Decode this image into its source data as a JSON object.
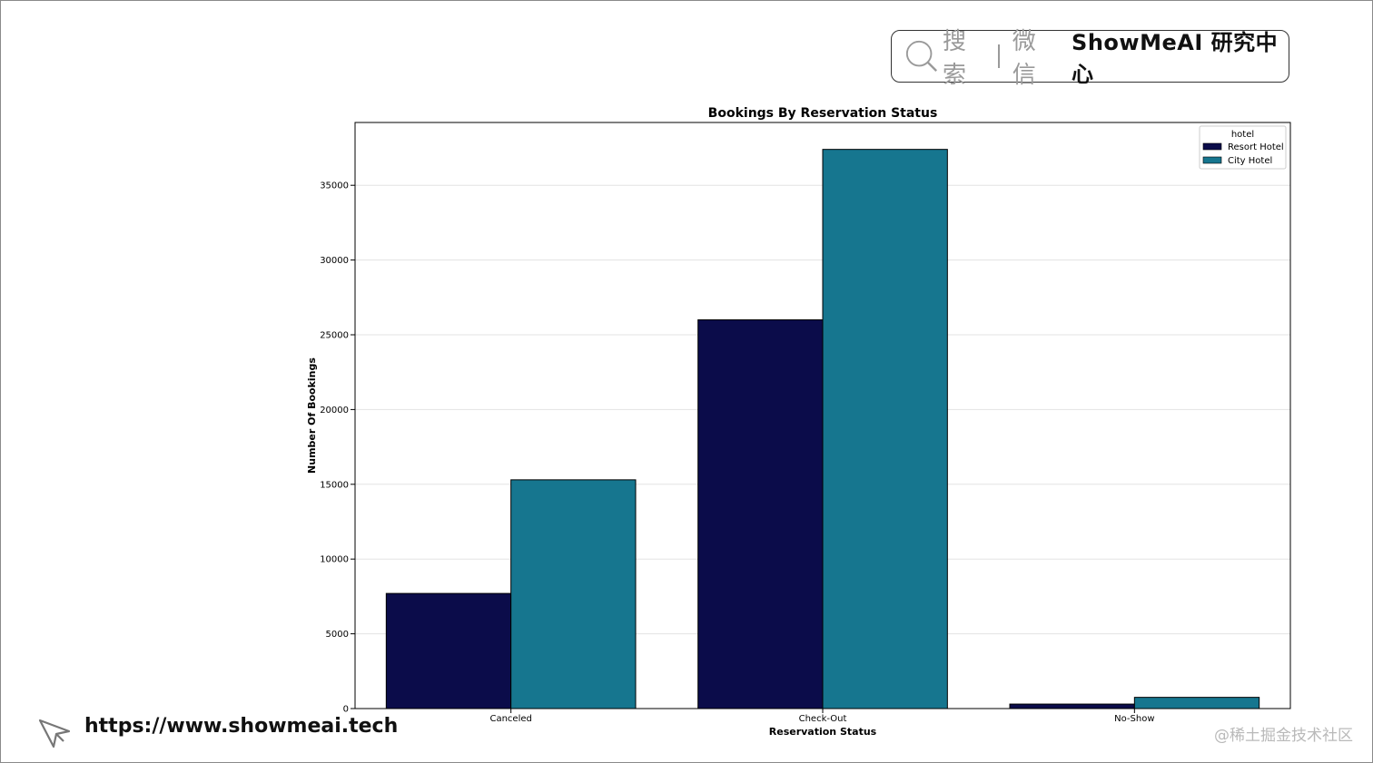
{
  "header": {
    "search_hint": "搜索",
    "wechat_hint": "微信",
    "brand": "ShowMeAI 研究中心"
  },
  "footer": {
    "url": "https://www.showmeai.tech",
    "watermark": "@稀土掘金技术社区"
  },
  "colors": {
    "resort": "#0b0c4a",
    "city": "#16768f",
    "grid": "#e3e3e3"
  },
  "chart_data": {
    "type": "bar",
    "title": "Bookings By Reservation Status",
    "xlabel": "Reservation Status",
    "ylabel": "Number Of Bookings",
    "categories": [
      "Canceled",
      "Check-Out",
      "No-Show"
    ],
    "series": [
      {
        "name": "Resort Hotel",
        "values": [
          7700,
          26000,
          300
        ]
      },
      {
        "name": "City Hotel",
        "values": [
          15300,
          37400,
          750
        ]
      }
    ],
    "ylim": [
      0,
      39200
    ],
    "yticks": [
      0,
      5000,
      10000,
      15000,
      20000,
      25000,
      30000,
      35000
    ],
    "legend": {
      "title": "hotel",
      "placement": "top-right"
    },
    "grid": "horizontal"
  }
}
